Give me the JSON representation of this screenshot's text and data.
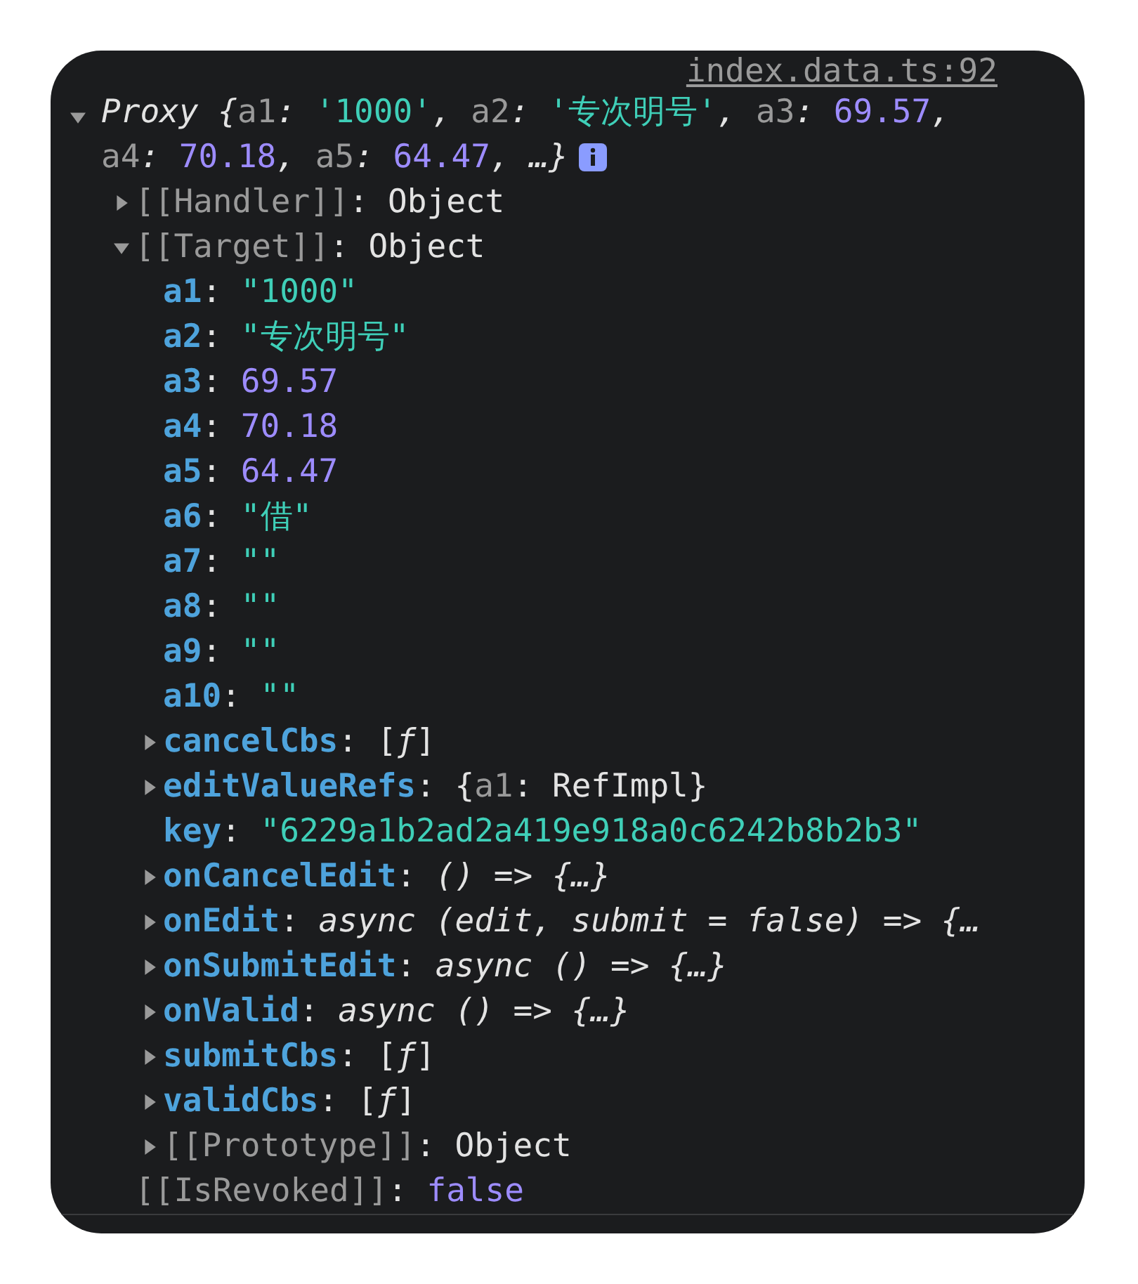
{
  "source_link": "index.data.ts:92",
  "summary": {
    "expanded": true,
    "segments": [
      {
        "text": "Proxy ",
        "kind": "italic"
      },
      {
        "text": "{",
        "kind": "italic"
      },
      {
        "text": "a1",
        "kind": "key"
      },
      {
        "text": ": ",
        "kind": "italic"
      },
      {
        "text": "'1000'",
        "kind": "string"
      },
      {
        "text": ", ",
        "kind": "italic"
      },
      {
        "text": "a2",
        "kind": "key"
      },
      {
        "text": ": ",
        "kind": "italic"
      },
      {
        "text": "'专次明号'",
        "kind": "string"
      },
      {
        "text": ", ",
        "kind": "italic"
      },
      {
        "text": "a3",
        "kind": "key"
      },
      {
        "text": ": ",
        "kind": "italic"
      },
      {
        "text": "69.57",
        "kind": "number"
      },
      {
        "text": ", ",
        "kind": "italic"
      },
      {
        "text": "a4",
        "kind": "key"
      },
      {
        "text": ": ",
        "kind": "italic"
      },
      {
        "text": "70.18",
        "kind": "number"
      },
      {
        "text": ", ",
        "kind": "italic"
      },
      {
        "text": "a5",
        "kind": "key"
      },
      {
        "text": ": ",
        "kind": "italic"
      },
      {
        "text": "64.47",
        "kind": "number"
      },
      {
        "text": ", …}",
        "kind": "italic"
      }
    ]
  },
  "tree": [
    {
      "key": "[[Handler]]",
      "internal": true,
      "kind": "expandable",
      "expanded": false,
      "value": [
        {
          "text": ": ",
          "kind": "plain"
        },
        {
          "text": "Object",
          "kind": "plain"
        }
      ]
    },
    {
      "key": "[[Target]]",
      "internal": true,
      "kind": "expandable",
      "expanded": true,
      "value": [
        {
          "text": ": ",
          "kind": "plain"
        },
        {
          "text": "Object",
          "kind": "plain"
        }
      ],
      "children": [
        {
          "key": "a1",
          "internal": false,
          "kind": "leaf",
          "value": [
            {
              "text": ": ",
              "kind": "plain"
            },
            {
              "text": "\"1000\"",
              "kind": "string"
            }
          ]
        },
        {
          "key": "a2",
          "internal": false,
          "kind": "leaf",
          "value": [
            {
              "text": ": ",
              "kind": "plain"
            },
            {
              "text": "\"专次明号\"",
              "kind": "string"
            }
          ]
        },
        {
          "key": "a3",
          "internal": false,
          "kind": "leaf",
          "value": [
            {
              "text": ": ",
              "kind": "plain"
            },
            {
              "text": "69.57",
              "kind": "number"
            }
          ]
        },
        {
          "key": "a4",
          "internal": false,
          "kind": "leaf",
          "value": [
            {
              "text": ": ",
              "kind": "plain"
            },
            {
              "text": "70.18",
              "kind": "number"
            }
          ]
        },
        {
          "key": "a5",
          "internal": false,
          "kind": "leaf",
          "value": [
            {
              "text": ": ",
              "kind": "plain"
            },
            {
              "text": "64.47",
              "kind": "number"
            }
          ]
        },
        {
          "key": "a6",
          "internal": false,
          "kind": "leaf",
          "value": [
            {
              "text": ": ",
              "kind": "plain"
            },
            {
              "text": "\"借\"",
              "kind": "string"
            }
          ]
        },
        {
          "key": "a7",
          "internal": false,
          "kind": "leaf",
          "value": [
            {
              "text": ": ",
              "kind": "plain"
            },
            {
              "text": "\"\"",
              "kind": "string"
            }
          ]
        },
        {
          "key": "a8",
          "internal": false,
          "kind": "leaf",
          "value": [
            {
              "text": ": ",
              "kind": "plain"
            },
            {
              "text": "\"\"",
              "kind": "string"
            }
          ]
        },
        {
          "key": "a9",
          "internal": false,
          "kind": "leaf",
          "value": [
            {
              "text": ": ",
              "kind": "plain"
            },
            {
              "text": "\"\"",
              "kind": "string"
            }
          ]
        },
        {
          "key": "a10",
          "internal": false,
          "kind": "leaf",
          "value": [
            {
              "text": ": ",
              "kind": "plain"
            },
            {
              "text": "\"\"",
              "kind": "string"
            }
          ]
        },
        {
          "key": "cancelCbs",
          "internal": false,
          "kind": "expandable",
          "expanded": false,
          "value": [
            {
              "text": ": ",
              "kind": "plain"
            },
            {
              "text": "[",
              "kind": "plain"
            },
            {
              "text": "ƒ",
              "kind": "italic"
            },
            {
              "text": "]",
              "kind": "plain"
            }
          ]
        },
        {
          "key": "editValueRefs",
          "internal": false,
          "kind": "expandable",
          "expanded": false,
          "value": [
            {
              "text": ": ",
              "kind": "plain"
            },
            {
              "text": "{",
              "kind": "plain"
            },
            {
              "text": "a1",
              "kind": "key"
            },
            {
              "text": ": RefImpl}",
              "kind": "plain"
            }
          ]
        },
        {
          "key": "key",
          "internal": false,
          "kind": "leaf",
          "value": [
            {
              "text": ": ",
              "kind": "plain"
            },
            {
              "text": "\"6229a1b2ad2a419e918a0c6242b8b2b3\"",
              "kind": "string"
            }
          ]
        },
        {
          "key": "onCancelEdit",
          "internal": false,
          "kind": "expandable",
          "expanded": false,
          "value": [
            {
              "text": ": ",
              "kind": "plain"
            },
            {
              "text": "() => {…}",
              "kind": "italic"
            }
          ]
        },
        {
          "key": "onEdit",
          "internal": false,
          "kind": "expandable",
          "expanded": false,
          "value": [
            {
              "text": ": ",
              "kind": "plain"
            },
            {
              "text": "async (edit, submit = false) => {…",
              "kind": "italic"
            }
          ]
        },
        {
          "key": "onSubmitEdit",
          "internal": false,
          "kind": "expandable",
          "expanded": false,
          "value": [
            {
              "text": ": ",
              "kind": "plain"
            },
            {
              "text": "async () => {…}",
              "kind": "italic"
            }
          ]
        },
        {
          "key": "onValid",
          "internal": false,
          "kind": "expandable",
          "expanded": false,
          "value": [
            {
              "text": ": ",
              "kind": "plain"
            },
            {
              "text": "async () => {…}",
              "kind": "italic"
            }
          ]
        },
        {
          "key": "submitCbs",
          "internal": false,
          "kind": "expandable",
          "expanded": false,
          "value": [
            {
              "text": ": ",
              "kind": "plain"
            },
            {
              "text": "[",
              "kind": "plain"
            },
            {
              "text": "ƒ",
              "kind": "italic"
            },
            {
              "text": "]",
              "kind": "plain"
            }
          ]
        },
        {
          "key": "validCbs",
          "internal": false,
          "kind": "expandable",
          "expanded": false,
          "value": [
            {
              "text": ": ",
              "kind": "plain"
            },
            {
              "text": "[",
              "kind": "plain"
            },
            {
              "text": "ƒ",
              "kind": "italic"
            },
            {
              "text": "]",
              "kind": "plain"
            }
          ]
        },
        {
          "key": "[[Prototype]]",
          "internal": true,
          "kind": "expandable",
          "expanded": false,
          "value": [
            {
              "text": ": ",
              "kind": "plain"
            },
            {
              "text": "Object",
              "kind": "plain"
            }
          ]
        }
      ]
    },
    {
      "key": "[[IsRevoked]]",
      "internal": true,
      "kind": "leaf",
      "value": [
        {
          "text": ": ",
          "kind": "plain"
        },
        {
          "text": "false",
          "kind": "number"
        }
      ]
    }
  ]
}
